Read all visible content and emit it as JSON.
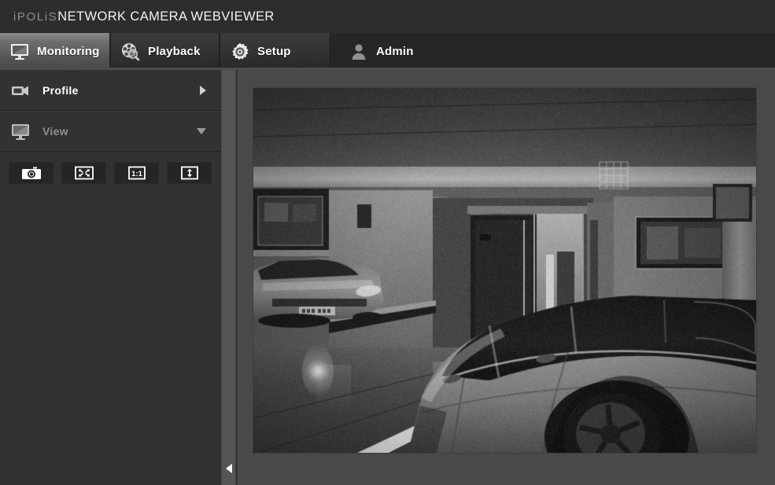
{
  "header": {
    "brand": "iPOLiS",
    "product": "NETWORK CAMERA WEBVIEWER"
  },
  "tabs": [
    {
      "id": "monitoring",
      "label": "Monitoring",
      "icon": "monitor-icon",
      "active": true
    },
    {
      "id": "playback",
      "label": "Playback",
      "icon": "film-reel-search-icon",
      "active": false
    },
    {
      "id": "setup",
      "label": "Setup",
      "icon": "gear-icon",
      "active": false
    },
    {
      "id": "admin",
      "label": "Admin",
      "icon": "user-icon",
      "active": false
    }
  ],
  "sidebar": {
    "items": [
      {
        "id": "profile",
        "label": "Profile",
        "icon": "camcorder-icon",
        "arrow": "chevron-right-icon",
        "expanded": false
      },
      {
        "id": "view",
        "label": "View",
        "icon": "monitor-icon",
        "arrow": "chevron-down-icon",
        "expanded": true
      }
    ],
    "toolbar": [
      {
        "id": "capture",
        "icon": "camera-icon",
        "title": "Capture"
      },
      {
        "id": "fullscreen",
        "icon": "fullscreen-icon",
        "title": "Full Screen"
      },
      {
        "id": "actual-size",
        "icon": "one-to-one-icon",
        "label": "1:1",
        "title": "Actual Size"
      },
      {
        "id": "fit-screen",
        "icon": "fit-vertical-icon",
        "title": "Fit To Screen"
      }
    ],
    "collapse_handle": "chevron-left-icon"
  },
  "video": {
    "scene": "grayscale parking garage surveillance view with a silver minivan in the foreground, a parked sedan at the left, and glass elevator doors in the center"
  },
  "colors": {
    "header_bg": "#2e2d2d",
    "tabbar_bg": "#262626",
    "active_tab": "#6f6f6f",
    "sidebar_bg": "#333232",
    "panel_bg": "#4a4949",
    "text_primary": "#ffffff",
    "text_muted": "#8f8e8e"
  }
}
